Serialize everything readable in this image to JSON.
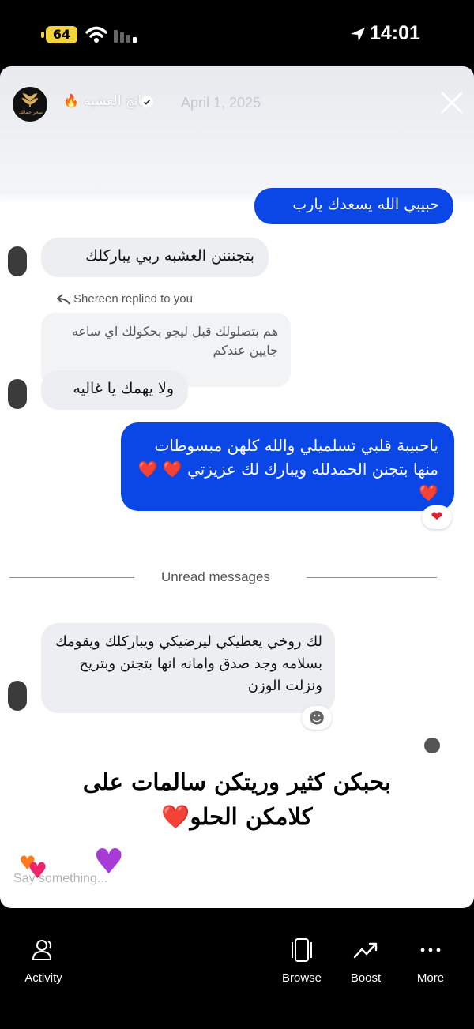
{
  "status_bar": {
    "battery": "64",
    "time": "14:01"
  },
  "story": {
    "author": "نتائج العشبه",
    "date": "April 1, 2025",
    "avatar_text": "سحر جمالك",
    "caption_line1": "بحبكن كثير وريتكن سالمات على",
    "caption_line2": "كلامكن الحلو❤️",
    "reply_placeholder": "Say something..."
  },
  "chat": {
    "top_sent": "حبيبي الله يسعدك يارب",
    "msg1": "بتجنننن العشبه ربي يباركلك",
    "reply_label": "Shereen replied to you",
    "quoted": "هم بتصلولك قبل ليجو بحكولك اي ساعه جايين عندكم",
    "msg2": "ولا يهمك يا غاليه",
    "sent_main": "ياحبيبة قلبي تسلميلي والله كلهن مبسوطات منها بتجنن الحمدلله ويبارك لك عزيزتي ❤️ ❤️❤️",
    "unread": "Unread messages",
    "msg3": "لك روخي يعطيكي ليرضيكي ويباركلك ويقومك بسلامه وجد صدق وامانه انها بتجنن وبتريح ونزلت الوزن"
  },
  "nav": {
    "activity": "Activity",
    "browse": "Browse",
    "boost": "Boost",
    "more": "More"
  }
}
